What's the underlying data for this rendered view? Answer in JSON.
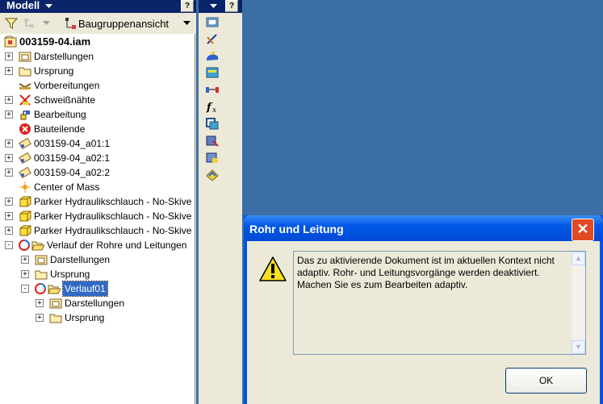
{
  "browser": {
    "title": "Modell",
    "view_label": "Baugruppenansicht",
    "help": "?"
  },
  "tree": {
    "root": "003159-04.iam",
    "items": [
      {
        "label": "Darstellungen"
      },
      {
        "label": "Ursprung"
      },
      {
        "label": "Vorbereitungen"
      },
      {
        "label": "Schweißnähte"
      },
      {
        "label": "Bearbeitung"
      },
      {
        "label": "Bauteilende"
      },
      {
        "label": "003159-04_a01:1"
      },
      {
        "label": "003159-04_a02:1"
      },
      {
        "label": "003159-04_a02:2"
      },
      {
        "label": "Center of Mass"
      },
      {
        "label": "Parker Hydraulikschlauch - No-Skive"
      },
      {
        "label": "Parker Hydraulikschlauch - No-Skive"
      },
      {
        "label": "Parker Hydraulikschlauch - No-Skive"
      },
      {
        "label": "Verlauf der Rohre und Leitungen"
      },
      {
        "label": "Darstellungen"
      },
      {
        "label": "Ursprung"
      },
      {
        "label": "Verlauf01"
      },
      {
        "label": "Darstellungen"
      },
      {
        "label": "Ursprung"
      }
    ]
  },
  "dialog": {
    "title": "Rohr und Leitung",
    "message": "Das zu aktivierende Dokument ist im aktuellen Kontext nicht adaptiv. Rohr- und Leitungsvorgänge werden deaktiviert. Machen Sie es zum Bearbeiten adaptiv.",
    "ok_label": "OK",
    "close_glyph": "✕"
  },
  "colors": {
    "desktop": "#3A6EA5",
    "title_active": "#0054E3",
    "selection": "#316AC5"
  }
}
